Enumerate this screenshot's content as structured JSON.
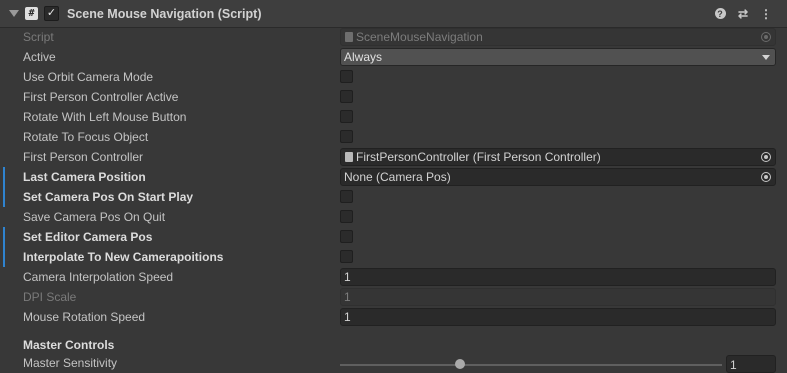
{
  "header": {
    "title": "Scene Mouse Navigation (Script)",
    "enabled": true,
    "icons": [
      "foldout-arrow-icon",
      "script-icon",
      "help-icon",
      "preset-icon",
      "more-menu-icon"
    ]
  },
  "fields": {
    "script": {
      "label": "Script",
      "value": "SceneMouseNavigation"
    },
    "active": {
      "label": "Active",
      "value": "Always"
    },
    "use_orbit_camera_mode": {
      "label": "Use Orbit Camera Mode",
      "checked": false
    },
    "first_person_controller_active": {
      "label": "First Person Controller Active",
      "checked": false
    },
    "rotate_with_left_mouse_button": {
      "label": "Rotate With Left Mouse Button",
      "checked": false
    },
    "rotate_to_focus_object": {
      "label": "Rotate To Focus Object",
      "checked": false
    },
    "first_person_controller": {
      "label": "First Person Controller",
      "value": "FirstPersonController (First Person Controller)"
    },
    "last_camera_position": {
      "label": "Last Camera Position",
      "value": "None (Camera Pos)"
    },
    "set_camera_pos_on_start_play": {
      "label": "Set Camera Pos On Start Play",
      "checked": false
    },
    "save_camera_pos_on_quit": {
      "label": "Save Camera Pos On Quit",
      "checked": false
    },
    "set_editor_camera_pos": {
      "label": "Set Editor Camera Pos",
      "checked": false
    },
    "interpolate_to_new_camerapoitions": {
      "label": "Interpolate To New Camerapoitions",
      "checked": false
    },
    "camera_interpolation_speed": {
      "label": "Camera Interpolation Speed",
      "value": "1"
    },
    "dpi_scale": {
      "label": "DPI Scale",
      "value": "1"
    },
    "mouse_rotation_speed": {
      "label": "Mouse Rotation Speed",
      "value": "1"
    }
  },
  "master_controls": {
    "section_label": "Master Controls",
    "master_sensitivity": {
      "label": "Master Sensitivity",
      "value": "1"
    }
  },
  "colors": {
    "background": "#383838",
    "header_background": "#3e3e3e",
    "override_marker": "#2f83cf"
  }
}
